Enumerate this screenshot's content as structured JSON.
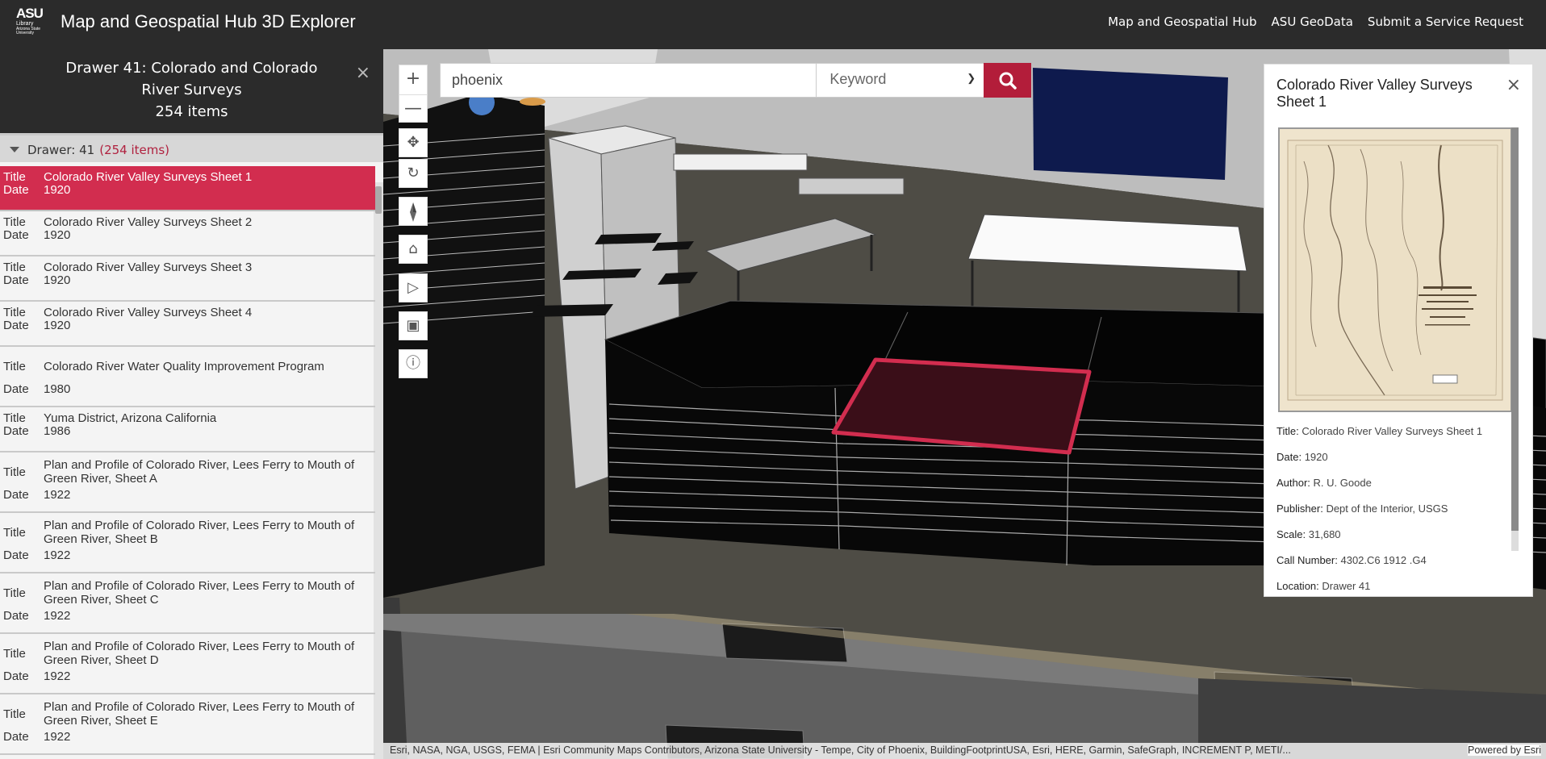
{
  "header": {
    "logo_line1": "ASU",
    "logo_line2": "Library",
    "logo_line3": "Arizona State University",
    "title": "Map and Geospatial Hub 3D Explorer",
    "nav": [
      "Map and Geospatial Hub",
      "ASU GeoData",
      "Submit a Service Request"
    ]
  },
  "sidebar": {
    "heading_line1": "Drawer 41: Colorado and Colorado",
    "heading_line2": "River Surveys",
    "heading_count": "254 items",
    "close": "×",
    "group_label": "Drawer: 41",
    "group_count": "(254 items)",
    "title_key": "Title",
    "date_key": "Date",
    "items": [
      {
        "title": "Colorado River Valley Surveys Sheet 1",
        "date": "1920",
        "selected": true
      },
      {
        "title": "Colorado River Valley Surveys Sheet 2",
        "date": "1920"
      },
      {
        "title": "Colorado River Valley Surveys Sheet 3",
        "date": "1920"
      },
      {
        "title": "Colorado River Valley Surveys Sheet 4",
        "date": "1920"
      },
      {
        "title": "Colorado River Water Quality Improvement Program",
        "date": "1980"
      },
      {
        "title": "Yuma District, Arizona California",
        "date": "1986"
      },
      {
        "title": "Plan and Profile of Colorado River, Lees Ferry to Mouth of Green River, Sheet A",
        "date": "1922"
      },
      {
        "title": "Plan and Profile of Colorado River, Lees Ferry to Mouth of Green River, Sheet B",
        "date": "1922"
      },
      {
        "title": "Plan and Profile of Colorado River, Lees Ferry to Mouth of Green River, Sheet C",
        "date": "1922"
      },
      {
        "title": "Plan and Profile of Colorado River, Lees Ferry to Mouth of Green River, Sheet D",
        "date": "1922"
      },
      {
        "title": "Plan and Profile of Colorado River, Lees Ferry to Mouth of Green River, Sheet E",
        "date": "1922"
      }
    ]
  },
  "search": {
    "value": "phoenix",
    "type": "Keyword"
  },
  "map_tools": {
    "zoom_in": "+",
    "zoom_out": "—"
  },
  "popup": {
    "title": "Colorado River Valley Surveys Sheet 1",
    "close": "×",
    "attributes": [
      {
        "label": "Title:",
        "value": "Colorado River Valley Surveys Sheet 1"
      },
      {
        "label": "Date:",
        "value": "1920"
      },
      {
        "label": "Author:",
        "value": "R. U. Goode"
      },
      {
        "label": "Publisher:",
        "value": "Dept of the Interior, USGS"
      },
      {
        "label": "Scale:",
        "value": "31,680"
      },
      {
        "label": "Call Number:",
        "value": "4302.C6 1912 .G4"
      },
      {
        "label": "Location:",
        "value": "Drawer 41"
      }
    ]
  },
  "attribution": {
    "text": "Esri, NASA, NGA, USGS, FEMA | Esri Community Maps Contributors, Arizona State University - Tempe, City of Phoenix, BuildingFootprintUSA, Esri, HERE, Garmin, SafeGraph, INCREMENT P, METI/...",
    "powered": "Powered by Esri"
  },
  "colors": {
    "header_bg": "#2b2b2b",
    "accent": "#d22d4f",
    "search_button": "#b31d3a"
  }
}
